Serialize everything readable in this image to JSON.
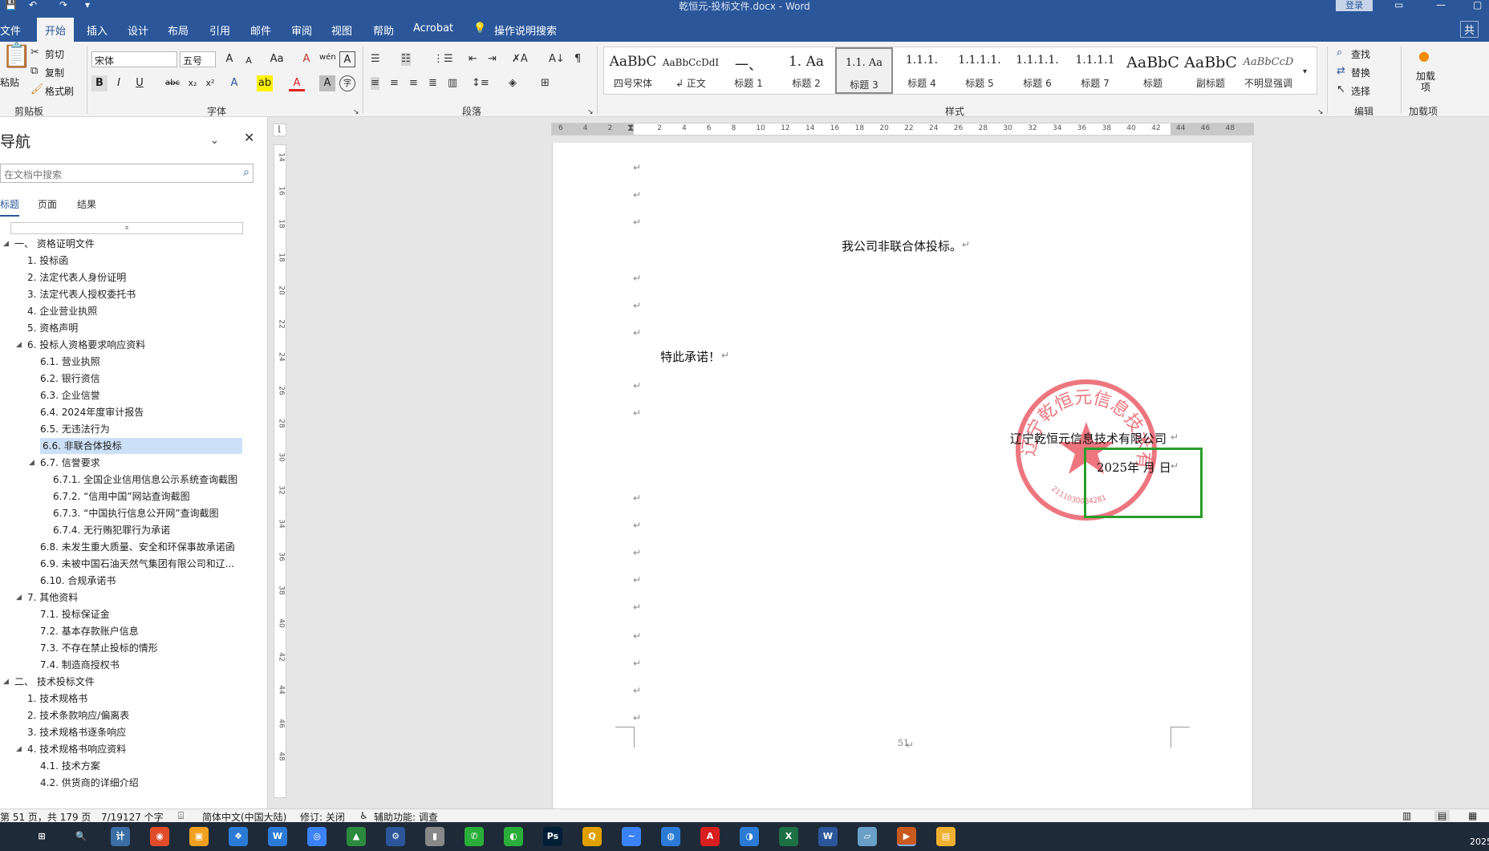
{
  "window": {
    "title": "乾恒元-投标文件.docx  -  Word",
    "login_label": "登录",
    "quick_access": {
      "save": "💾",
      "undo": "↶",
      "redo": "↷",
      "more": "▾"
    }
  },
  "tabs": [
    "文件",
    "开始",
    "插入",
    "设计",
    "布局",
    "引用",
    "邮件",
    "审阅",
    "视图",
    "帮助",
    "Acrobat"
  ],
  "active_tab": "开始",
  "tell_me": "操作说明搜索",
  "share_label": "共",
  "ribbon": {
    "clipboard": {
      "paste": "粘贴",
      "cut": "剪切",
      "copy": "复制",
      "painter": "格式刷",
      "label": "剪贴板"
    },
    "font": {
      "name": "宋体",
      "size": "五号",
      "label": "字体",
      "grow": "A",
      "shrink": "A",
      "case": "Aa",
      "clear": "A",
      "phonetic": "wén",
      "border": "A",
      "bold": "B",
      "italic": "I",
      "underline": "U",
      "strike": "abc",
      "sub": "x₂",
      "sup": "x²",
      "effects": "A",
      "highlight": "ab",
      "color": "A",
      "shade": "A",
      "circle": "字"
    },
    "paragraph": {
      "label": "段落"
    },
    "styles": {
      "label": "样式",
      "items": [
        {
          "preview": "AaBbC",
          "name": "四号宋体"
        },
        {
          "preview": "AaBbCcDdI",
          "name": "↲ 正文"
        },
        {
          "preview": "一、",
          "name": "标题 1"
        },
        {
          "preview": "1.  Aa",
          "name": "标题 2"
        },
        {
          "preview": "1.1.  Aa",
          "name": "标题 3"
        },
        {
          "preview": "1.1.1.",
          "name": "标题 4"
        },
        {
          "preview": "1.1.1.1.",
          "name": "标题 5"
        },
        {
          "preview": "1.1.1.1.",
          "name": "标题 6"
        },
        {
          "preview": "1.1.1.1",
          "name": "标题 7"
        },
        {
          "preview": "AaBbC",
          "name": "标题"
        },
        {
          "preview": "AaBbC",
          "name": "副标题"
        },
        {
          "preview": "AaBbCcD",
          "name": "不明显强调"
        }
      ],
      "selected_index": 4
    },
    "editing": {
      "find": "查找",
      "replace": "替换",
      "select": "选择",
      "label": "编辑"
    },
    "addins": {
      "item": "加载项",
      "label": "加载项"
    }
  },
  "nav": {
    "title": "导航",
    "search_placeholder": "在文档中搜索",
    "tabs": [
      "标题",
      "页面",
      "结果"
    ],
    "active_tab": "标题",
    "items": [
      {
        "text": "一、 资格证明文件",
        "level": 0,
        "tri": "◢"
      },
      {
        "text": "1. 投标函",
        "level": 1,
        "tri": ""
      },
      {
        "text": "2. 法定代表人身份证明",
        "level": 1,
        "tri": ""
      },
      {
        "text": "3. 法定代表人授权委托书",
        "level": 1,
        "tri": ""
      },
      {
        "text": "4. 企业营业执照",
        "level": 1,
        "tri": ""
      },
      {
        "text": "5. 资格声明",
        "level": 1,
        "tri": ""
      },
      {
        "text": "6. 投标人资格要求响应资料",
        "level": 1,
        "tri": "◢"
      },
      {
        "text": "6.1. 营业执照",
        "level": 2,
        "tri": ""
      },
      {
        "text": "6.2. 银行资信",
        "level": 2,
        "tri": ""
      },
      {
        "text": "6.3. 企业信誉",
        "level": 2,
        "tri": ""
      },
      {
        "text": "6.4. 2024年度审计报告",
        "level": 2,
        "tri": ""
      },
      {
        "text": "6.5. 无违法行为",
        "level": 2,
        "tri": ""
      },
      {
        "text": "6.6. 非联合体投标",
        "level": 2,
        "tri": "",
        "selected": true
      },
      {
        "text": "6.7. 信誉要求",
        "level": 2,
        "tri": "◢"
      },
      {
        "text": "6.7.1. 全国企业信用信息公示系统查询截图",
        "level": 3,
        "tri": ""
      },
      {
        "text": "6.7.2. “信用中国”网站查询截图",
        "level": 3,
        "tri": ""
      },
      {
        "text": "6.7.3. “中国执行信息公开网”查询截图",
        "level": 3,
        "tri": ""
      },
      {
        "text": "6.7.4. 无行贿犯罪行为承诺",
        "level": 3,
        "tri": ""
      },
      {
        "text": "6.8. 未发生重大质量、安全和环保事故承诺函",
        "level": 2,
        "tri": ""
      },
      {
        "text": "6.9. 未被中国石油天然气集团有限公司和辽...",
        "level": 2,
        "tri": ""
      },
      {
        "text": "6.10. 合规承诺书",
        "level": 2,
        "tri": ""
      },
      {
        "text": "7. 其他资料",
        "level": 1,
        "tri": "◢"
      },
      {
        "text": "7.1. 投标保证金",
        "level": 2,
        "tri": ""
      },
      {
        "text": "7.2. 基本存款账户信息",
        "level": 2,
        "tri": ""
      },
      {
        "text": "7.3. 不存在禁止投标的情形",
        "level": 2,
        "tri": ""
      },
      {
        "text": "7.4. 制造商授权书",
        "level": 2,
        "tri": ""
      },
      {
        "text": "二、 技术投标文件",
        "level": 0,
        "tri": "◢"
      },
      {
        "text": "1. 技术规格书",
        "level": 1,
        "tri": ""
      },
      {
        "text": "2. 技术条款响应/偏离表",
        "level": 1,
        "tri": ""
      },
      {
        "text": "3. 技术规格书逐条响应",
        "level": 1,
        "tri": ""
      },
      {
        "text": "4. 技术规格书响应资料",
        "level": 1,
        "tri": "◢"
      },
      {
        "text": "4.1. 技术方案",
        "level": 2,
        "tri": ""
      },
      {
        "text": "4.2. 供货商的详细介绍",
        "level": 2,
        "tri": ""
      }
    ]
  },
  "ruler": {
    "h_ticks": [
      "6",
      "4",
      "2",
      "",
      "2",
      "4",
      "6",
      "8",
      "10",
      "12",
      "14",
      "16",
      "18",
      "20",
      "22",
      "24",
      "26",
      "28",
      "30",
      "32",
      "34",
      "36",
      "38",
      "40",
      "42",
      "44",
      "46",
      "48"
    ],
    "v_ticks": [
      "14",
      "16",
      "18",
      "18",
      "20",
      "22",
      "24",
      "26",
      "28",
      "30",
      "32",
      "34",
      "36",
      "38",
      "40",
      "42",
      "44",
      "46",
      "48"
    ]
  },
  "document": {
    "para_mark": "↵",
    "line1": "我公司非联合体投标。",
    "line2": "特此承诺！",
    "company": "辽宁乾恒元信息技术有限公司",
    "date": "2025年  月  日",
    "page_number": "51",
    "seal_text": "辽宁乾恒元信息技术有限公司",
    "seal_number": "2111030084281",
    "seal_color": "#e8505b",
    "highlight_color": "#2a9d2a"
  },
  "status": {
    "page": "第 51 页，共 179 页",
    "words": "7/19127 个字",
    "lang": "简体中文(中国大陆)",
    "track": "修订: 关闭",
    "access": "辅助功能: 调查"
  },
  "taskbar": {
    "apps": [
      "⊞",
      "🔍",
      "计",
      "◉",
      "▣",
      "❖",
      "W",
      "◎",
      "▲",
      "⚙",
      "▮",
      "✆",
      "◐",
      "Ps",
      "Q",
      "~",
      "◍",
      "A",
      "◑",
      "X",
      "W",
      "▱",
      "▶",
      "▤"
    ],
    "time": "2025"
  }
}
